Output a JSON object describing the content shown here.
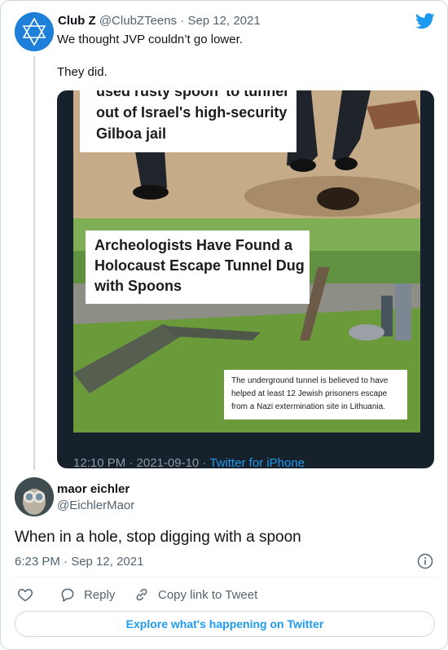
{
  "quoted_tweet": {
    "avatar_icon": "star-of-david-icon",
    "avatar_text": "CLUB Z",
    "display_name": "Club Z",
    "handle": "@ClubZTeens",
    "separator": "·",
    "date": "Sep 12, 2021",
    "text_line1": "We thought JVP couldn’t go lower.",
    "text_line2": "They did.",
    "media": {
      "caption_top": "used rusty spoon' to tunnel out of Israel's high-security Gilboa jail",
      "caption_main": "Archeologists Have Found a Holocaust Escape Tunnel Dug with Spoons",
      "caption_small": "The underground tunnel is believed to have helped at least 12 Jewish prisoners escape from a Nazi extermination site in Lithuania.",
      "footer_time": "12:10 PM · 2021-09-10 · ",
      "footer_source": "Twitter for iPhone"
    }
  },
  "main_tweet": {
    "display_name": "maor eichler",
    "handle": "@EichlerMaor",
    "text": "When in a hole, stop digging with a spoon",
    "time": "6:23 PM · Sep 12, 2021"
  },
  "actions": {
    "reply_label": "Reply",
    "copy_label": "Copy link to Tweet"
  },
  "explore_label": "Explore what's happening on Twitter",
  "colors": {
    "twitter_blue": "#1d9bf0",
    "text_primary": "#0f1419",
    "text_secondary": "#536471",
    "border": "#cfd9de"
  }
}
